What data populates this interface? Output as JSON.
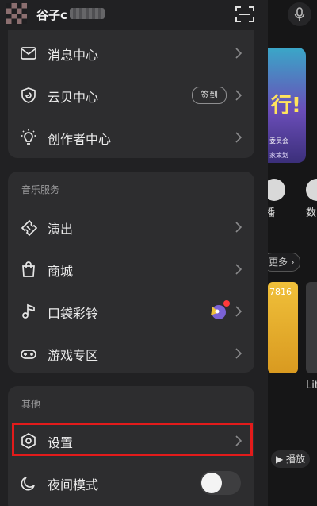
{
  "header": {
    "username": "谷子c"
  },
  "groups": [
    {
      "title": "",
      "items": [
        {
          "label": "消息中心",
          "icon": "mail-icon"
        },
        {
          "label": "云贝中心",
          "icon": "cloud-coin-icon",
          "badge": "签到"
        },
        {
          "label": "创作者中心",
          "icon": "lightbulb-icon"
        }
      ]
    },
    {
      "title": "音乐服务",
      "items": [
        {
          "label": "演出",
          "icon": "ticket-icon"
        },
        {
          "label": "商城",
          "icon": "shopping-bag-icon"
        },
        {
          "label": "口袋彩铃",
          "icon": "music-note-icon"
        },
        {
          "label": "游戏专区",
          "icon": "gamepad-icon"
        }
      ]
    },
    {
      "title": "其他",
      "items": [
        {
          "label": "设置",
          "icon": "settings-hexagon-icon"
        },
        {
          "label": "夜间模式",
          "icon": "moon-icon",
          "toggle": false
        }
      ]
    }
  ],
  "background": {
    "banner_big": "行!",
    "banner_small": "委员会",
    "banner_sub": "家策划",
    "left_label": "播",
    "right_label": "数",
    "more_label": "更多",
    "card_number": "7816",
    "card_caption": "Lit",
    "play_label": "播放"
  },
  "colors": {
    "drawer": "#212123",
    "card": "#2d2d2f",
    "highlight": "#e21b1b"
  }
}
